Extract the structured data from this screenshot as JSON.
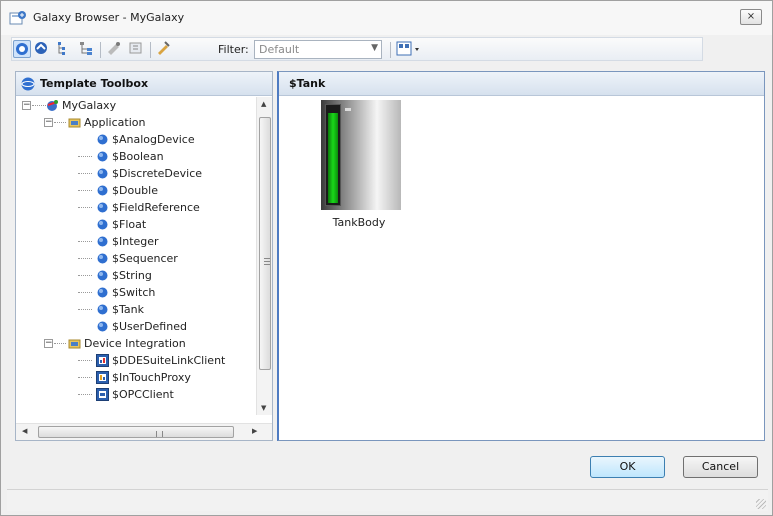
{
  "window": {
    "title": "Galaxy Browser - MyGalaxy",
    "close_label": "⨯"
  },
  "toolbar": {
    "filter_label": "Filter:",
    "filter_value": "Default",
    "buttons": [
      "template-toolbox-icon",
      "graphic-toolbox-icon",
      "tree-view-icon",
      "derivation-view-icon",
      "assign-icon",
      "deploy-icon",
      "properties-icon"
    ]
  },
  "left_panel": {
    "header": "Template Toolbox",
    "tree": [
      {
        "label": "MyGalaxy",
        "level": 0,
        "expander": "−",
        "icon": "galaxy-icon"
      },
      {
        "label": "Application",
        "level": 1,
        "expander": "−",
        "icon": "folder-icon"
      },
      {
        "label": "$AnalogDevice",
        "level": 2,
        "icon": "template-icon"
      },
      {
        "label": "$Boolean",
        "level": 2,
        "icon": "template-icon"
      },
      {
        "label": "$DiscreteDevice",
        "level": 2,
        "icon": "template-icon"
      },
      {
        "label": "$Double",
        "level": 2,
        "icon": "template-icon"
      },
      {
        "label": "$FieldReference",
        "level": 2,
        "icon": "template-icon"
      },
      {
        "label": "$Float",
        "level": 2,
        "icon": "template-icon"
      },
      {
        "label": "$Integer",
        "level": 2,
        "icon": "template-icon"
      },
      {
        "label": "$Sequencer",
        "level": 2,
        "icon": "template-icon"
      },
      {
        "label": "$String",
        "level": 2,
        "icon": "template-icon"
      },
      {
        "label": "$Switch",
        "level": 2,
        "icon": "template-icon"
      },
      {
        "label": "$Tank",
        "level": 2,
        "icon": "template-icon"
      },
      {
        "label": "$UserDefined",
        "level": 2,
        "icon": "template-icon"
      },
      {
        "label": "Device Integration",
        "level": 1,
        "expander": "−",
        "icon": "folder-icon"
      },
      {
        "label": "$DDESuiteLinkClient",
        "level": 2,
        "icon": "di-object-icon"
      },
      {
        "label": "$InTouchProxy",
        "level": 2,
        "icon": "di-object-icon"
      },
      {
        "label": "$OPCClient",
        "level": 2,
        "icon": "di-object-icon"
      }
    ]
  },
  "right_panel": {
    "header": "$Tank",
    "items": [
      {
        "label": "TankBody"
      }
    ]
  },
  "buttons": {
    "ok": "OK",
    "cancel": "Cancel"
  },
  "colors": {
    "accent": "#4e7bc2",
    "tank_fill": "#1ad81a"
  }
}
